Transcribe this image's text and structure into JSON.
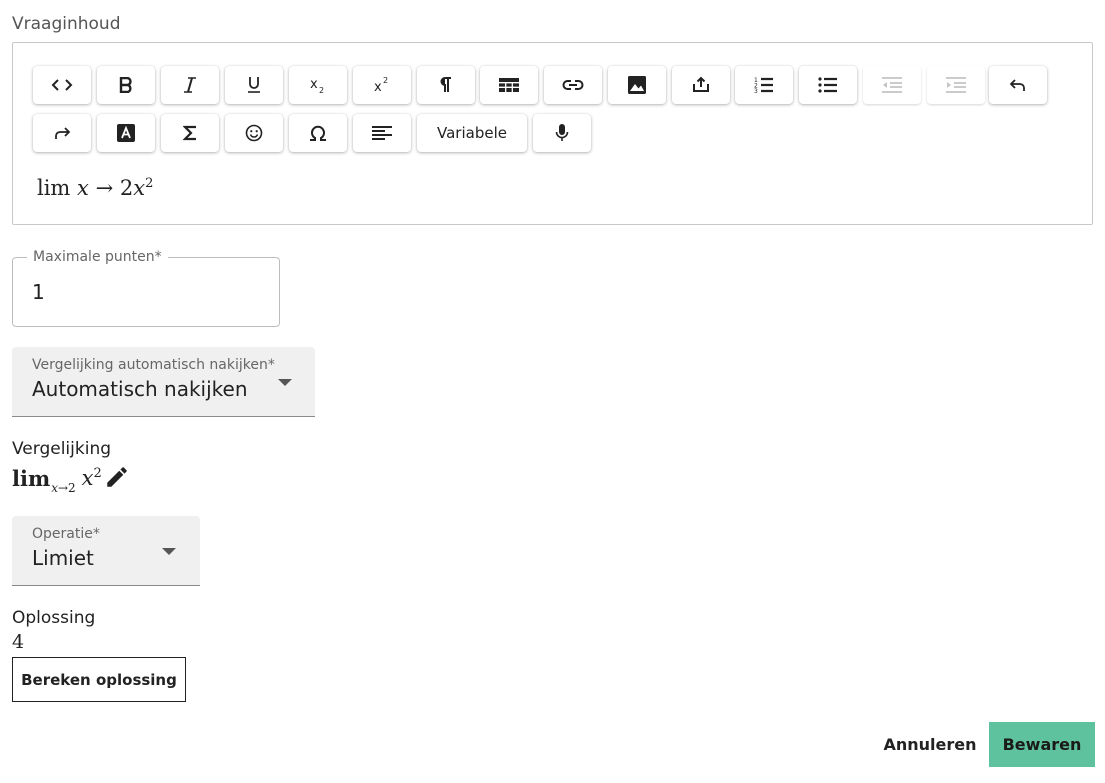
{
  "editor": {
    "label": "Vraaginhoud",
    "toolbar": {
      "variable_label": "Variabele",
      "icons": [
        "code-view-icon",
        "bold-icon",
        "italic-icon",
        "underline-icon",
        "subscript-icon",
        "superscript-icon",
        "paragraph-icon",
        "table-icon",
        "link-icon",
        "image-icon",
        "upload-icon",
        "ordered-list-icon",
        "unordered-list-icon",
        "indent-decrease-icon",
        "indent-increase-icon",
        "undo-icon",
        "redo-icon",
        "text-color-icon",
        "sigma-icon",
        "emoji-icon",
        "omega-icon",
        "align-left-icon",
        "variable-button",
        "microphone-icon"
      ]
    },
    "content": {
      "lim": "lim",
      "var": "x",
      "arrow": "→",
      "coef": "2",
      "var2": "x",
      "exp": "2"
    }
  },
  "max_points": {
    "label": "Maximale punten*",
    "value": "1"
  },
  "compare_select": {
    "label": "Vergelijking automatisch nakijken*",
    "value": "Automatisch nakijken"
  },
  "equation": {
    "label": "Vergelijking",
    "lim": "lim",
    "sub_var": "x",
    "sub_arrow": "→",
    "sub_val": "2",
    "var": "x",
    "exp": "2",
    "edit_icon": "pencil-icon"
  },
  "operation_select": {
    "label": "Operatie*",
    "value": "Limiet"
  },
  "solution": {
    "label": "Oplossing",
    "value": "4",
    "compute_button": "Bereken oplossing"
  },
  "actions": {
    "cancel": "Annuleren",
    "save": "Bewaren"
  },
  "colors": {
    "primary": "#5ec29f",
    "border": "#c8c8c8",
    "filled_bg": "#f0f0f0",
    "disabled": "#c4c4c4"
  }
}
